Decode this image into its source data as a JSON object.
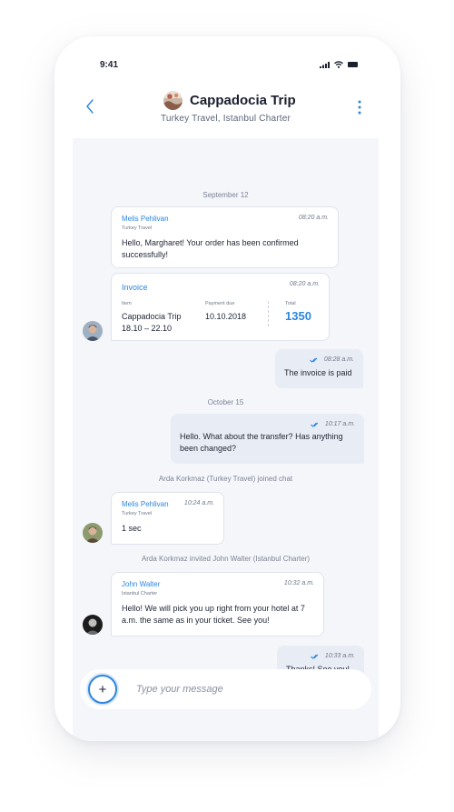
{
  "status": {
    "time": "9:41"
  },
  "header": {
    "title": "Cappadocia Trip",
    "subtitle": "Turkey Travel, Istanbul Charter"
  },
  "chat": {
    "date1": "September 12",
    "msg1": {
      "sender": "Melis Pehlivan",
      "company": "Turkey Travel",
      "time": "08:20 a.m.",
      "text": "Hello, Margharet! Your order has been confirmed successfully!"
    },
    "invoice": {
      "label": "Invoice",
      "time": "08:20 a.m.",
      "item_head": "Item",
      "item_line1": "Cappadocia Trip",
      "item_line2": "18.10 – 22.10",
      "due_head": "Payment due",
      "due_value": "10.10.2018",
      "total_head": "Total",
      "total_value": "1350"
    },
    "out1": {
      "time": "08:28 a.m.",
      "text": "The invoice is paid"
    },
    "date2": "October 15",
    "out2": {
      "time": "10:17 a.m.",
      "text": "Hello. What about the transfer? Has anything been changed?"
    },
    "sys1": "Arda Korkmaz (Turkey Travel) joined chat",
    "msg2": {
      "sender": "Melis Pehlivan",
      "company": "Turkey Travel",
      "time": "10:24 a.m.",
      "text": "1 sec"
    },
    "sys2": "Arda Korkmaz invited John Walter (Istanbul Charter)",
    "msg3": {
      "sender": "John Walter",
      "company": "Istanbul Charter",
      "time": "10:32 a.m.",
      "text": "Hello! We will pick you up right from your hotel at 7 a.m. the same as in your ticket. See you!"
    },
    "out3": {
      "time": "10:33 a.m.",
      "text": "Thanks! See you!"
    }
  },
  "composer": {
    "placeholder": "Type your message",
    "add_label": "+"
  },
  "colors": {
    "accent": "#2e86de",
    "bubble_out": "#e8ecf4",
    "chat_bg": "#f4f6fa"
  },
  "icons": {
    "back": "chevron-left-icon",
    "menu": "more-vertical-icon",
    "read": "double-check-icon",
    "add": "plus-icon"
  }
}
